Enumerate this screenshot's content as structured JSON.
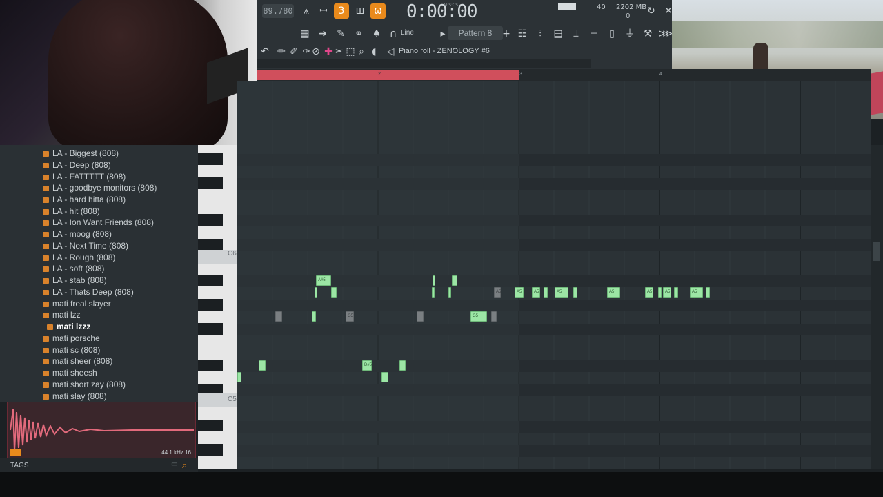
{
  "toolbar": {
    "tempo": "89.780",
    "time": "0:00:00",
    "time_units": "M:S:CS",
    "cpu": "40",
    "memory": "2202 MB",
    "voices": "0",
    "snap": "Line",
    "pattern": "Pattern 8",
    "piano_roll_title": "Piano roll - ZENOLOGY #6"
  },
  "timeline": {
    "bar2": "2",
    "bar3": "3",
    "bar4": "4"
  },
  "browser": {
    "items": [
      "LA - Biggest (808)",
      "LA - Deep (808)",
      "LA - FATTTTT (808)",
      "LA - goodbye monitors (808)",
      "LA - hard hitta (808)",
      "LA - hit (808)",
      "LA - Ion Want Friends (808)",
      "LA - moog (808)",
      "LA - Next Time (808)",
      "LA - Rough (808)",
      "LA - soft (808)",
      "LA - stab (808)",
      "LA - Thats Deep (808)",
      "mati freal slayer",
      "mati lzz",
      "mati lzzz",
      "mati porsche",
      "mati sc (808)",
      "mati sheer (808)",
      "mati sheesh",
      "mati short zay (808)",
      "mati slay (808)"
    ]
  },
  "sample_info": "44.1 kHz 16",
  "tags_label": "TAGS",
  "keys": {
    "c6": "C6",
    "c5": "C5"
  },
  "notes": {
    "a5": "A5",
    "g5": "G5",
    "d5s": "D#5",
    "a5s": "A#5"
  },
  "colors": {
    "accent": "#e98a1c",
    "note": "#9ce6a5",
    "loop": "#d04f5c"
  }
}
